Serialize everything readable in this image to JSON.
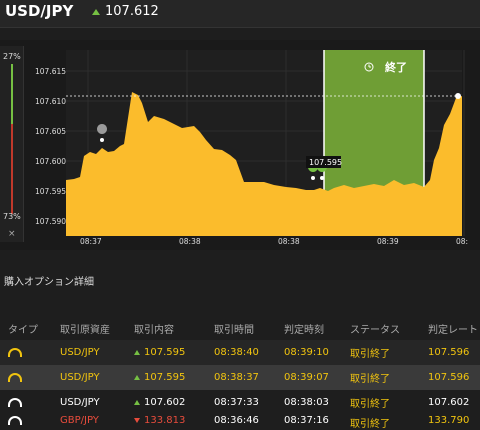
{
  "header": {
    "pair": "USD/JPY",
    "price": "107.612"
  },
  "side": {
    "top_pct": "27%",
    "bottom_pct": "73%",
    "close": "×"
  },
  "chart_data": {
    "type": "area",
    "y_ticks": [
      "107.615",
      "107.610",
      "107.605",
      "107.600",
      "107.595",
      "107.590"
    ],
    "x_ticks": [
      "08:37",
      "08:38",
      "08:38",
      "08:39",
      "08:"
    ],
    "zone_label": "終了",
    "marker_label": "107.595",
    "ylim": [
      107.5875,
      107.6185
    ],
    "series_color": "#fbbc2c"
  },
  "section": {
    "title": "購入オプション詳細"
  },
  "table": {
    "headers": [
      "タイプ",
      "取引原資産",
      "取引内容",
      "取引時間",
      "判定時刻",
      "ステータス",
      "判定レート"
    ],
    "rows": [
      {
        "asset": "USD/JPY",
        "direction": "up",
        "content": "107.595",
        "time": "08:38:40",
        "judge": "08:39:10",
        "status": "取引終了",
        "rate": "107.596",
        "style": "gold"
      },
      {
        "asset": "USD/JPY",
        "direction": "up",
        "content": "107.595",
        "time": "08:38:37",
        "judge": "08:39:07",
        "status": "取引終了",
        "rate": "107.596",
        "style": "gold-hl"
      },
      {
        "asset": "USD/JPY",
        "direction": "up",
        "content": "107.602",
        "time": "08:37:33",
        "judge": "08:38:03",
        "status": "取引終了",
        "rate": "107.602",
        "style": "white"
      },
      {
        "asset": "GBP/JPY",
        "direction": "down",
        "content": "133.813",
        "time": "08:36:46",
        "judge": "08:37:16",
        "status": "取引終了",
        "rate": "133.790",
        "style": "partial"
      }
    ]
  }
}
